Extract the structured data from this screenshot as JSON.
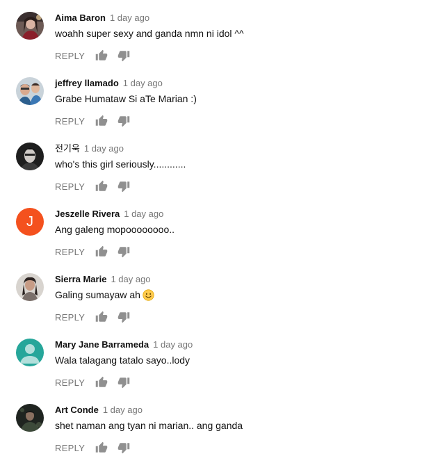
{
  "reply_label": "REPLY",
  "comments": [
    {
      "author": "Aima Baron",
      "time": "1 day ago",
      "text": "woahh super sexy and ganda nmn ni idol ^^",
      "avatar": "photo"
    },
    {
      "author": "jeffrey llamado",
      "time": "1 day ago",
      "text": "Grabe Humataw Si aTe Marian :)",
      "avatar": "photo"
    },
    {
      "author": "전기욱",
      "time": "1 day ago",
      "text": "who's this girl seriously............",
      "avatar": "photo"
    },
    {
      "author": "Jeszelle Rivera",
      "time": "1 day ago",
      "text": "Ang galeng mopoooooooo..",
      "avatar": "letter",
      "letter": "J",
      "color": "#f4511e"
    },
    {
      "author": "Sierra Marie",
      "time": "1 day ago",
      "text": "Galing sumayaw ah",
      "avatar": "photo",
      "emoji": "smiling-face-emoji"
    },
    {
      "author": "Mary Jane Barrameda",
      "time": "1 day ago",
      "text": "Wala talagang tatalo sayo..lody",
      "avatar": "default",
      "color": "#26a69a"
    },
    {
      "author": "Art Conde",
      "time": "1 day ago",
      "text": "shet naman ang tyan ni marian.. ang ganda",
      "avatar": "photo"
    }
  ],
  "icons": {
    "like": "thumbs-up-icon",
    "dislike": "thumbs-down-icon"
  },
  "colors": {
    "author": "#111111",
    "timestamp": "#767676",
    "icon": "#909090"
  }
}
